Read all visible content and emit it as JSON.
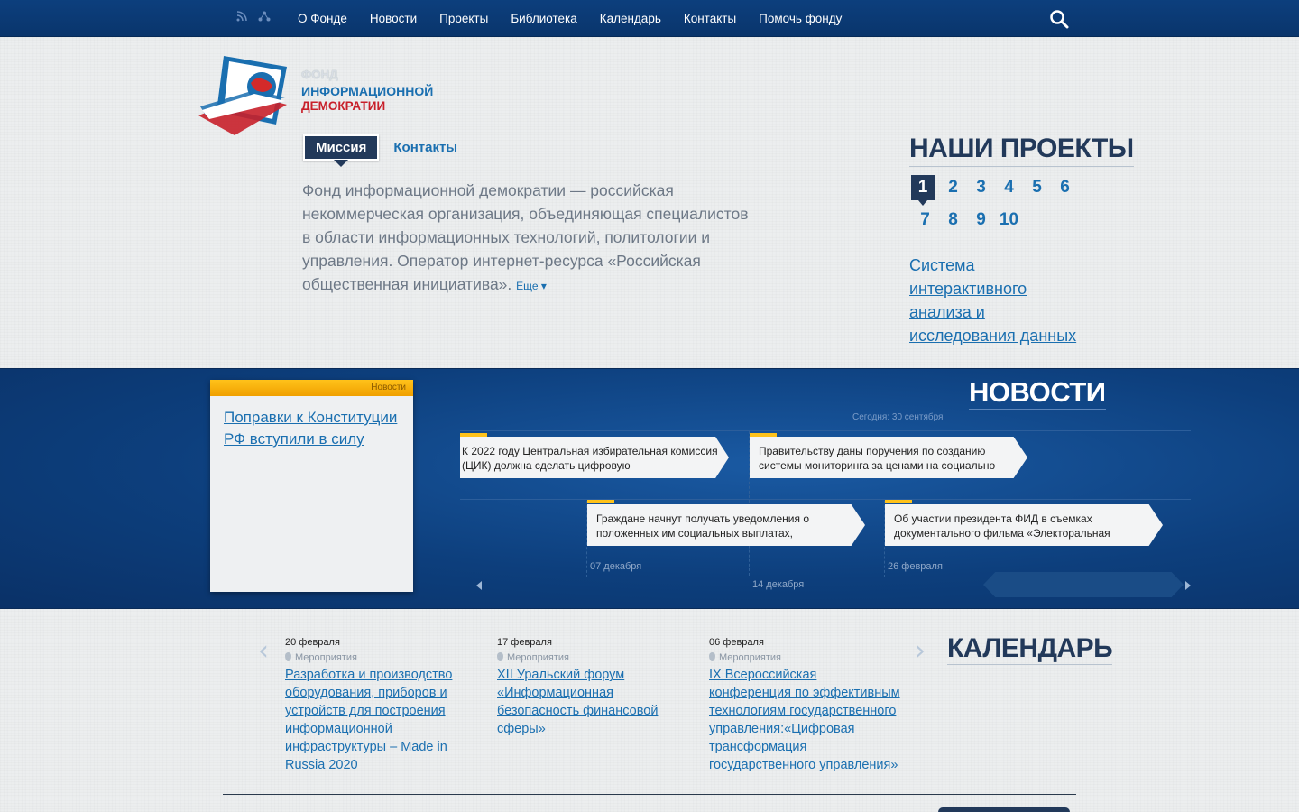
{
  "nav": {
    "items": [
      "О Фонде",
      "Новости",
      "Проекты",
      "Библиотека",
      "Календарь",
      "Контакты",
      "Помочь фонду"
    ]
  },
  "logo": {
    "line1": "ФОНД",
    "line2": "ИНФОРМАЦИОННОЙ",
    "line3": "ДЕМОКРАТИИ"
  },
  "mission": {
    "tab_active": "Миссия",
    "tab_other": "Контакты",
    "text": "Фонд информационной демократии — российская некоммерческая организация, объединяющая специалистов в области информационных технологий, политологии и управления. Оператор интернет-ресурса «Российская общественная инициатива».",
    "more": "Еще ▾"
  },
  "projects": {
    "title": "НАШИ ПРОЕКТЫ",
    "pages": [
      "1",
      "2",
      "3",
      "4",
      "5",
      "6",
      "7",
      "8",
      "9",
      "10"
    ],
    "active_page": "1",
    "link": "Система интерактивного анализа и исследования данных"
  },
  "news": {
    "title": "НОВОСТИ",
    "today": "Сегодня: 30 сентября",
    "featured_tag": "Новости",
    "featured_title": "Поправки к Конституции РФ вступили в силу",
    "items": [
      "К 2022 году Центральная избирательная комиссия (ЦИК) должна сделать цифровую",
      "Правительству даны поручения по созданию системы мониторинга за ценами на социально",
      "Граждане начнут получать уведомления о положенных им социальных выплатах,",
      "Об участии президента ФИД в съемках документального фильма «Электоральная"
    ],
    "dates": [
      "07 декабря",
      "14 декабря",
      "26 февраля"
    ]
  },
  "calendar": {
    "title": "КАЛЕНДАРЬ",
    "events": [
      {
        "date": "20 февраля",
        "category": "Мероприятия",
        "title": "Разработка и производство оборудования, приборов и устройств для построения информационной инфраструктуры – Made in Russia 2020"
      },
      {
        "date": "17 февраля",
        "category": "Мероприятия",
        "title": "XII Уральский форум «Информационная безопасность финансовой сферы»"
      },
      {
        "date": "06 февраля",
        "category": "Мероприятия",
        "title": "IX Всероссийская конференция по эффективным технологиям государственного управления:«Цифровая трансформация государственного управления»"
      }
    ]
  },
  "colors": {
    "brand_dark": "#22395a",
    "link": "#1a6fb0",
    "accent_yellow": "#ffc21a",
    "nav_bg": "#0c3f7d"
  }
}
